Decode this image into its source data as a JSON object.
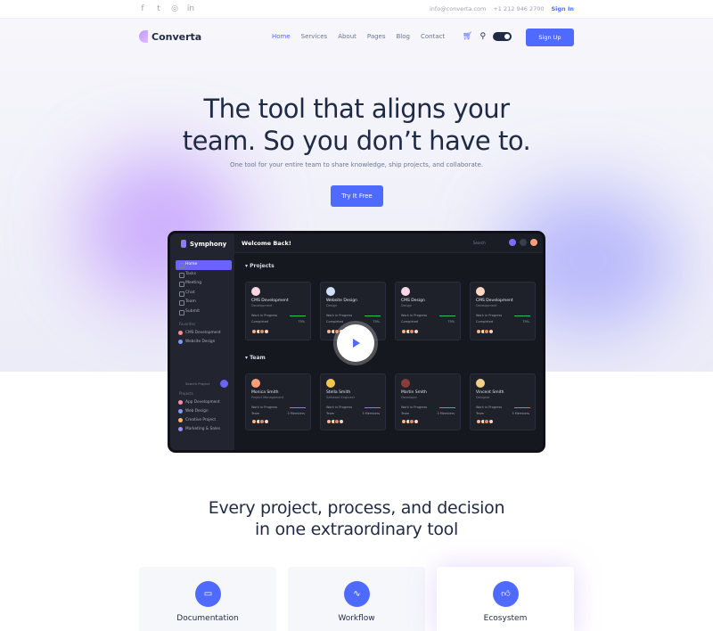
{
  "topbar": {
    "social": [
      "f",
      "t",
      "◎",
      "in"
    ],
    "email": "info@converta.com",
    "phone": "+1 212 946 2700",
    "signin": "Sign In"
  },
  "nav": {
    "brand": "Converta",
    "items": [
      "Home",
      "Services",
      "About",
      "Pages",
      "Blog",
      "Contact"
    ],
    "active": "Home",
    "signup": "Sign Up"
  },
  "hero": {
    "title_line1": "The tool that aligns your",
    "title_line2": "team. So you don’t have to.",
    "subtitle": "One tool for your entire team to share knowledge, ship projects, and collaborate.",
    "cta": "Try It Free"
  },
  "app": {
    "brand": "Symphony",
    "welcome": "Welcome Back!",
    "search": "Search",
    "menu": [
      "Home",
      "Tasks",
      "Meeting",
      "Chat",
      "Team",
      "Submit"
    ],
    "favorites_label": "Favorites",
    "favorites": [
      "CMS Development",
      "Website Design"
    ],
    "search_project": "Search Project",
    "projects_label": "Projects",
    "projects": [
      "App Development",
      "Web Design",
      "Creative Project",
      "Marketing & Sales"
    ],
    "projects_heading": "Projects",
    "team_heading": "Team",
    "project_cards": [
      {
        "title": "CMS Development",
        "sub": "Development",
        "status": "Work in Progress",
        "completed": "Completed",
        "pct": "75%"
      },
      {
        "title": "Website Design",
        "sub": "Design",
        "status": "Work in Progress",
        "completed": "Completed",
        "pct": "75%"
      },
      {
        "title": "CMS Design",
        "sub": "Design",
        "status": "Work in Progress",
        "completed": "Completed",
        "pct": "75%"
      },
      {
        "title": "CMS Development",
        "sub": "Development",
        "status": "Work in Progress",
        "completed": "Completed",
        "pct": "75%"
      }
    ],
    "team_cards": [
      {
        "name": "Monica Smith",
        "role": "Project Management",
        "status": "Work in Progress",
        "team": "Team",
        "members": "5 Members"
      },
      {
        "name": "Stella Smith",
        "role": "Software Engineer",
        "status": "Work in Progress",
        "team": "Team",
        "members": "5 Members"
      },
      {
        "name": "Martin Smith",
        "role": "Developer",
        "status": "Work in Progress",
        "team": "Team",
        "members": "5 Members"
      },
      {
        "name": "Vincent Smith",
        "role": "Designer",
        "status": "Work in Progress",
        "team": "Team",
        "members": "5 Members"
      }
    ]
  },
  "features": {
    "heading_line1": "Every project, process, and decision",
    "heading_line2": "in one extraordinary tool",
    "items": [
      {
        "title": "Documentation",
        "icon": "folder-icon"
      },
      {
        "title": "Workflow",
        "icon": "pulse-icon"
      },
      {
        "title": "Ecosystem",
        "icon": "thumbs-up-icon"
      }
    ]
  },
  "colors": {
    "accent": "#4f6bff",
    "app_accent": "#6c63ff",
    "dark": "#1f2a44"
  }
}
